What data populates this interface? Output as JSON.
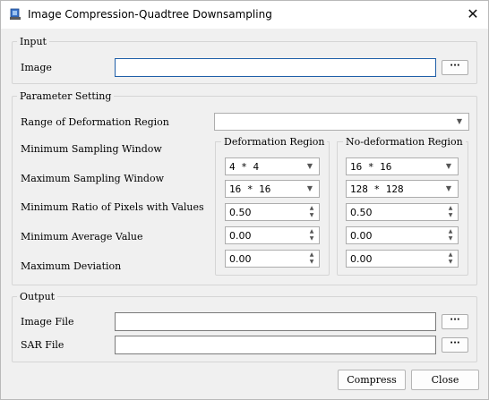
{
  "window": {
    "title": "Image Compression-Quadtree Downsampling",
    "app_icon": "app-icon",
    "close_glyph": "✕"
  },
  "input": {
    "legend": "Input",
    "image_label": "Image",
    "image_value": "",
    "browse_label": "···"
  },
  "params": {
    "legend": "Parameter Setting",
    "range_label": "Range of Deformation Region",
    "range_value": "",
    "row_labels": [
      "Minimum Sampling Window",
      "Maximum Sampling Window",
      "Minimum Ratio of Pixels with Values",
      "Minimum Average Value",
      "Maximum Deviation"
    ],
    "deformation": {
      "title": "Deformation Region",
      "min_window": "4 * 4",
      "max_window": "16 * 16",
      "min_ratio": "0.50",
      "min_avg": "0.00",
      "max_dev": "0.00"
    },
    "no_deformation": {
      "title": "No-deformation Region",
      "min_window": "16 * 16",
      "max_window": "128 * 128",
      "min_ratio": "0.50",
      "min_avg": "0.00",
      "max_dev": "0.00"
    }
  },
  "output": {
    "legend": "Output",
    "image_file_label": "Image File",
    "image_file_value": "",
    "sar_file_label": "SAR File",
    "sar_file_value": "",
    "browse_label": "···"
  },
  "footer": {
    "compress_label": "Compress",
    "close_label": "Close"
  },
  "colors": {
    "focus_border": "#1f5fa8",
    "window_bg": "#f0f0f0"
  }
}
